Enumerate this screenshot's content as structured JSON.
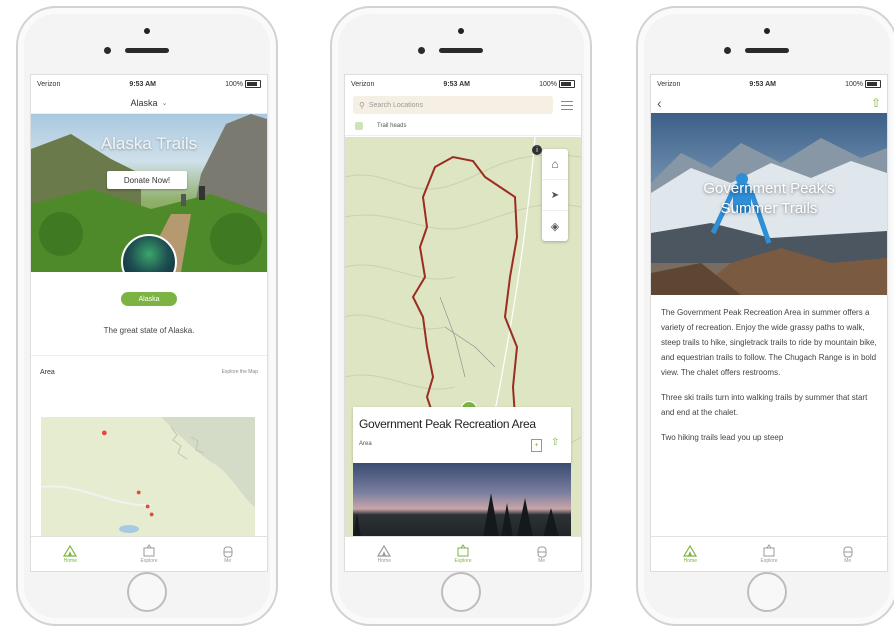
{
  "colors": {
    "accent": "#7cb342",
    "trail": "#9b2d20"
  },
  "phone1": {
    "status": {
      "carrier": "Verizon",
      "time": "9:53 AM",
      "battery": "100%"
    },
    "header_title": "Alaska",
    "hero_title": "Alaska Trails",
    "donate_label": "Donate Now!",
    "badge_label": "Alaska",
    "tagline": "The great state of Alaska.",
    "area_label": "Area",
    "explore_link": "Explore the Map",
    "tabs": [
      "Home",
      "Explore",
      "Me"
    ]
  },
  "phone2": {
    "status": {
      "carrier": "Verizon",
      "time": "9:53 AM",
      "battery": "100%"
    },
    "search_placeholder": "Search Locations",
    "filter_label": "Trail heads",
    "card_title": "Government Peak Recreation Area",
    "card_subtitle": "Area",
    "tabs": [
      "Home",
      "Explore",
      "Me"
    ]
  },
  "phone3": {
    "status": {
      "carrier": "Verizon",
      "time": "9:53 AM",
      "battery": "100%"
    },
    "hero_title": "Government Peak's Summer Trails",
    "paragraphs": [
      "The Government Peak Recreation Area in summer offers a variety of recreation. Enjoy the wide grassy paths to walk, steep trails to hike, singletrack trails to ride by mountain bike, and equestrian trails to follow. The Chugach Range is in bold view. The chalet offers restrooms.",
      "Three ski trails turn into walking trails by summer that start and end at the chalet.",
      "Two hiking trails lead you up steep"
    ],
    "tabs": [
      "Home",
      "Explore",
      "Me"
    ]
  }
}
